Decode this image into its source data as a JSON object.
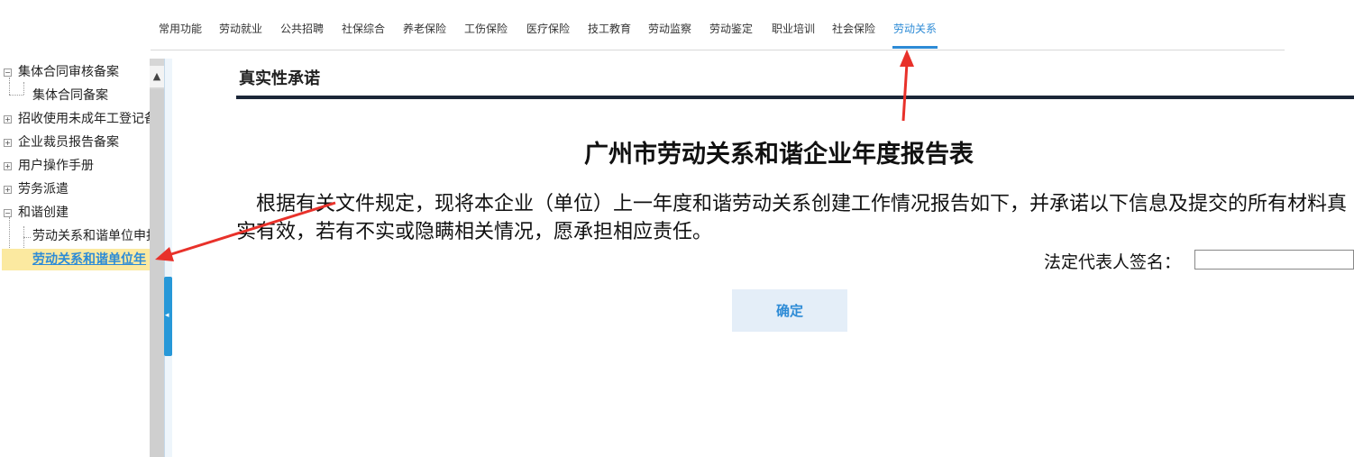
{
  "nav": {
    "items": [
      {
        "label": "常用功能"
      },
      {
        "label": "劳动就业"
      },
      {
        "label": "公共招聘"
      },
      {
        "label": "社保综合"
      },
      {
        "label": "养老保险"
      },
      {
        "label": "工伤保险"
      },
      {
        "label": "医疗保险"
      },
      {
        "label": "技工教育"
      },
      {
        "label": "劳动监察"
      },
      {
        "label": "劳动鉴定"
      },
      {
        "label": "职业培训"
      },
      {
        "label": "社会保险"
      },
      {
        "label": "劳动关系"
      }
    ],
    "active_index": 12,
    "accent_color": "#2d8bd6"
  },
  "sidebar": {
    "items": [
      {
        "label": "集体合同审核备案",
        "toggle": "−"
      },
      {
        "label": "集体合同备案"
      },
      {
        "label": "招收使用未成年工登记备",
        "toggle": "+"
      },
      {
        "label": "企业裁员报告备案",
        "toggle": "+"
      },
      {
        "label": "用户操作手册",
        "toggle": "+"
      },
      {
        "label": "劳务派遣",
        "toggle": "+"
      },
      {
        "label": "和谐创建",
        "toggle": "−"
      },
      {
        "label": "劳动关系和谐单位申报"
      },
      {
        "label": "劳动关系和谐单位年"
      }
    ],
    "selected_index": 8,
    "scroll_up_icon": "▲",
    "collapse_icon": "◂"
  },
  "main": {
    "section_title": "真实性承诺",
    "report_title": "广州市劳动关系和谐企业年度报告表",
    "body_text": "根据有关文件规定，现将本企业（单位）上一年度和谐劳动关系创建工作情况报告如下，并承诺以下信息及提交的所有材料真实有效，若有不实或隐瞒相关情况，愿承担相应责任。",
    "sign_label": "法定代表人签名：",
    "sign_value": "",
    "confirm_label": "确定"
  },
  "annotation_color": "#e8312a"
}
